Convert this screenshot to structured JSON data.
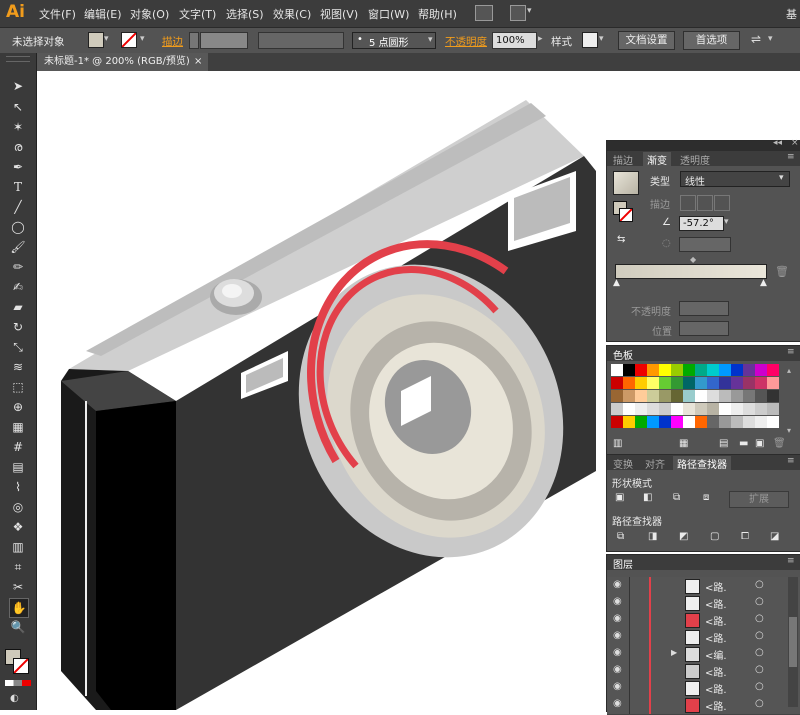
{
  "app": {
    "logo": "Ai"
  },
  "menu": [
    "文件(F)",
    "编辑(E)",
    "对象(O)",
    "文字(T)",
    "选择(S)",
    "效果(C)",
    "视图(V)",
    "窗口(W)",
    "帮助(H)"
  ],
  "menu_right": "基",
  "control": {
    "selection": "未选择对象",
    "stroke_label": "描边",
    "brush": "5 点圆形",
    "opacity_label": "不透明度",
    "opacity_value": "100%",
    "style_label": "样式",
    "doc_settings": "文档设置",
    "preferences": "首选项"
  },
  "document_tab": {
    "title": "未标题-1* @ 200% (RGB/预览)",
    "close": "×"
  },
  "gradient_panel": {
    "tabs": [
      "描边",
      "渐变",
      "透明度"
    ],
    "type_label": "类型",
    "type_value": "线性",
    "stroke_label": "描边",
    "angle_value": "-57.2°",
    "opacity_label": "不透明度",
    "location_label": "位置"
  },
  "swatches_panel": {
    "title": "色板"
  },
  "pathfinder_panel": {
    "tabs": [
      "变换",
      "对齐",
      "路径查找器"
    ],
    "shape_modes_label": "形状模式",
    "expand_button": "扩展",
    "pathfinders_label": "路径查找器"
  },
  "layers_panel": {
    "title": "图层",
    "rows": [
      "<路.",
      "<路.",
      "<路.",
      "<路.",
      "<编.",
      "<路.",
      "<路.",
      "<路."
    ]
  },
  "colors": {
    "accent": "#f19c1c",
    "camera_body": "#333333",
    "camera_top": "#cfcfcf",
    "lens_red": "#e2404a"
  }
}
